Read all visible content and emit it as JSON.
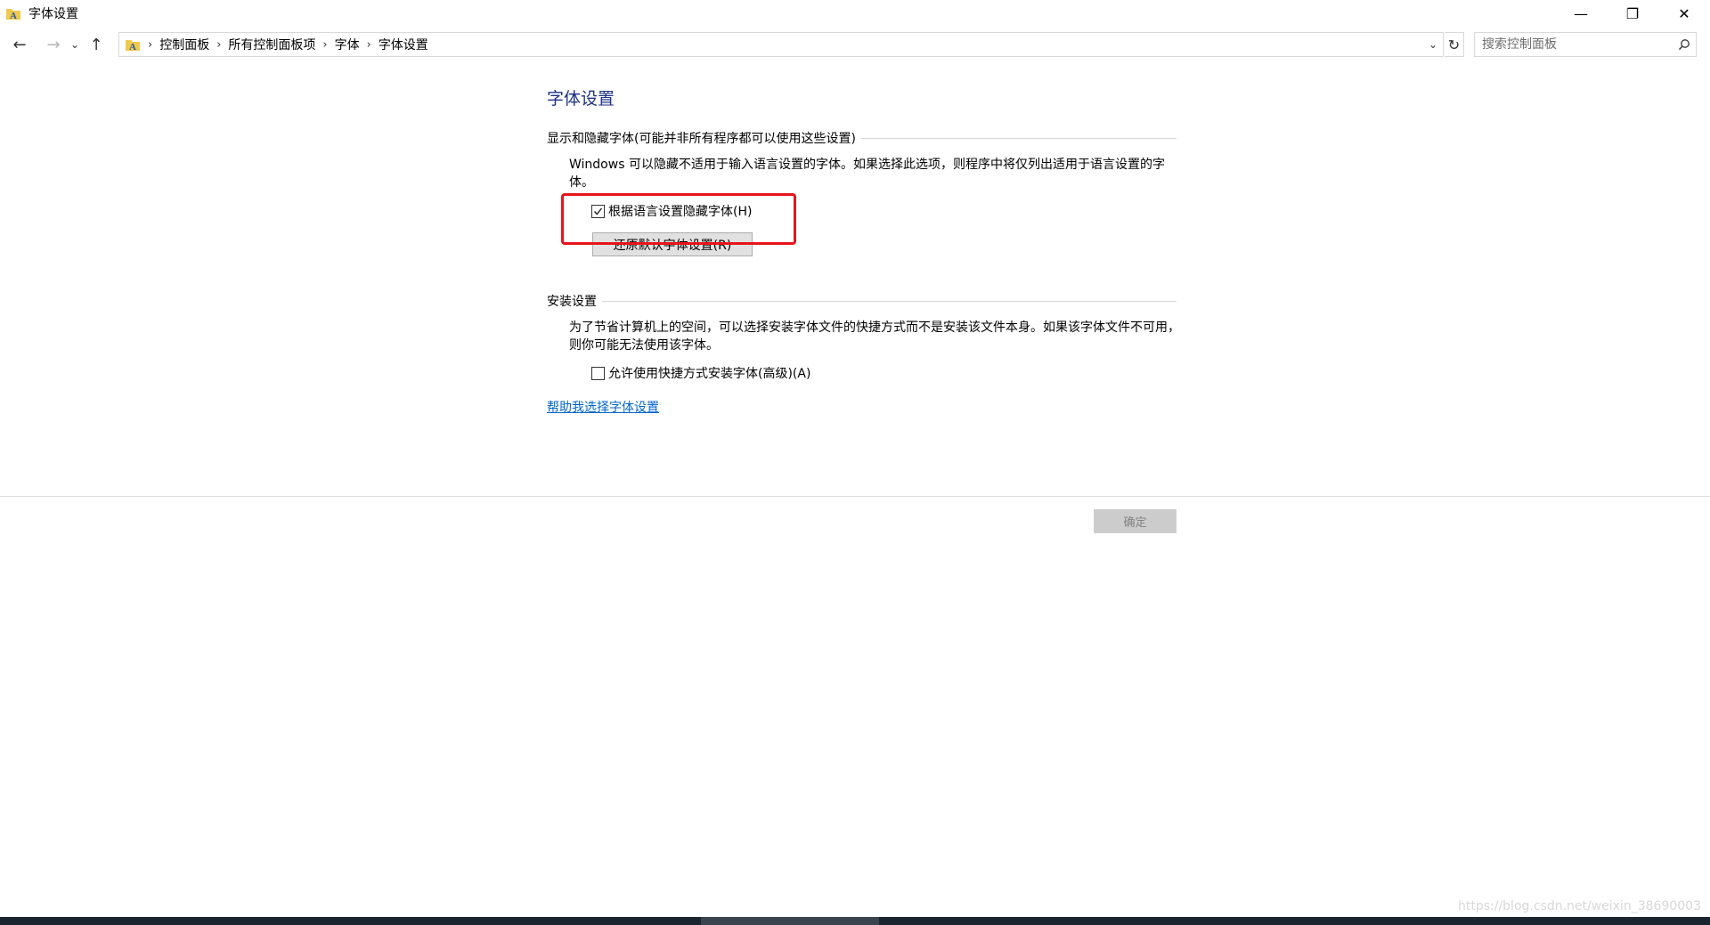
{
  "window": {
    "title": "字体设置",
    "controls": {
      "minimize": "—",
      "restore": "❐",
      "close": "✕"
    }
  },
  "nav": {
    "back_glyph": "←",
    "forward_glyph": "→",
    "recent_glyph": "⌄",
    "up_glyph": "↑",
    "breadcrumbs": [
      "控制面板",
      "所有控制面板项",
      "字体",
      "字体设置"
    ],
    "separator": "›",
    "refresh_glyph": "↻",
    "dropdown_glyph": "⌄"
  },
  "search": {
    "placeholder": "搜索控制面板"
  },
  "page": {
    "title": "字体设置",
    "show_hide_group": {
      "header": "显示和隐藏字体(可能并非所有程序都可以使用这些设置)",
      "description": "Windows 可以隐藏不适用于输入语言设置的字体。如果选择此选项，则程序中将仅列出适用于语言设置的字体。",
      "checkbox_label": "根据语言设置隐藏字体(H)",
      "checkbox_checked": true,
      "restore_button": "还原默认字体设置(R)"
    },
    "install_group": {
      "header": "安装设置",
      "description": "为了节省计算机上的空间，可以选择安装字体文件的快捷方式而不是安装该文件本身。如果该字体文件不可用，则你可能无法使用该字体。",
      "checkbox_label": "允许使用快捷方式安装字体(高级)(A)",
      "checkbox_checked": false
    },
    "help_link": "帮助我选择字体设置",
    "ok_button": "确定"
  },
  "watermark": "https://blog.csdn.net/weixin_38690003",
  "colors": {
    "title_blue": "#1e3287",
    "link_blue": "#0066cc",
    "highlight_red": "#e8141b"
  }
}
